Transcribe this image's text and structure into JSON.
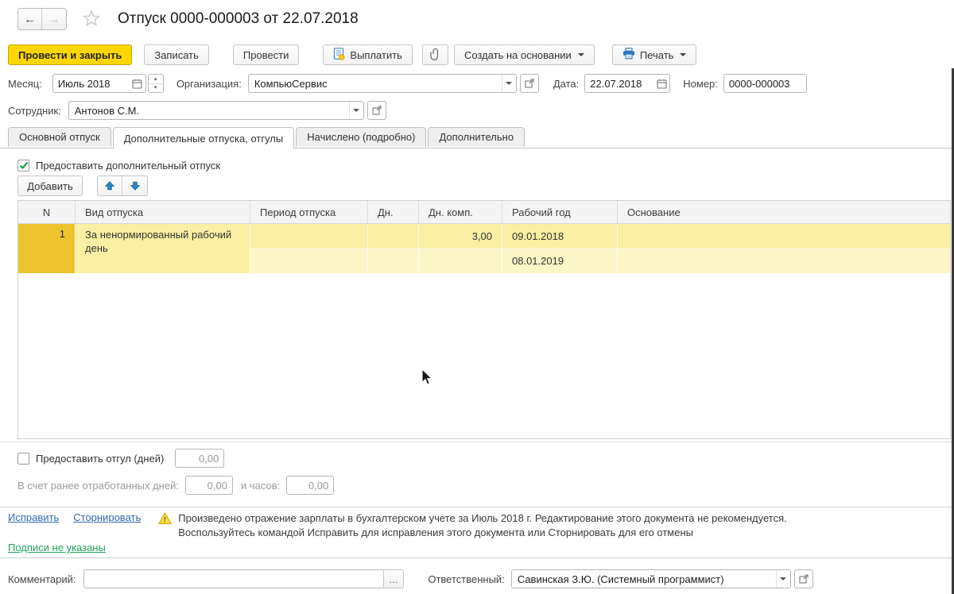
{
  "window": {
    "title": "Отпуск 0000-000003 от 22.07.2018"
  },
  "icons": {
    "back": "←",
    "forward": "→",
    "spin_up": "▴",
    "spin_down": "▾",
    "warning_glyph": "!"
  },
  "toolbar": {
    "post_and_close": "Провести и закрыть",
    "write": "Записать",
    "post": "Провести",
    "pay": "Выплатить",
    "create_based_on": "Создать на основании",
    "print": "Печать"
  },
  "header_fields": {
    "month_label": "Месяц:",
    "month_value": "Июль 2018",
    "organization_label": "Организация:",
    "organization_value": "КомпьюСервис",
    "date_label": "Дата:",
    "date_value": "22.07.2018",
    "number_label": "Номер:",
    "number_value": "0000-000003",
    "employee_label": "Сотрудник:",
    "employee_value": "Антонов С.М."
  },
  "tabs": [
    {
      "label": "Основной отпуск",
      "active": false
    },
    {
      "label": "Дополнительные отпуска, отгулы",
      "active": true
    },
    {
      "label": "Начислено (подробно)",
      "active": false
    },
    {
      "label": "Дополнительно",
      "active": false
    }
  ],
  "vacation_tab": {
    "grant_checkbox_label": "Предоставить дополнительный отпуск",
    "add_button": "Добавить",
    "table": {
      "columns": [
        "N",
        "Вид отпуска",
        "Период отпуска",
        "Дн.",
        "Дн. комп.",
        "Рабочий год",
        "Основание"
      ],
      "row": {
        "n": "1",
        "type": "За ненормированный рабочий день",
        "period_start": "",
        "period_end": "",
        "days": "",
        "days_comp": "3,00",
        "work_year_start": "09.01.2018",
        "work_year_end": "08.01.2019",
        "basis": ""
      }
    }
  },
  "time_off_section": {
    "grant_checkbox_label": "Предоставить отгул (дней)",
    "days_value": "0,00",
    "earned_days_label": "В счет ранее отработанных дней:",
    "earned_days_value": "0,00",
    "hours_label": "и часов:",
    "hours_value": "0,00"
  },
  "notice": {
    "fix_link": "Исправить",
    "reverse_link": "Сторнировать",
    "text_line1": "Произведено отражение зарплаты в бухгалтерском учете за Июль 2018 г. Редактирование этого документа не рекомендуется.",
    "text_line2": "Воспользуйтесь командой Исправить для исправления этого документа или Сторнировать для его отмены",
    "signatures_link": "Подписи не указаны"
  },
  "footer": {
    "comment_label": "Комментарий:",
    "comment_value": "",
    "more_button": "...",
    "responsible_label": "Ответственный:",
    "responsible_value": "Савинская З.Ю. (Системный программист)"
  },
  "colors": {
    "primary_button": "#fed702",
    "selected_row_marker": "#eec42e",
    "row_highlight": "#faefa2",
    "row_highlight_light": "#fcf5c6",
    "link": "#3169b3",
    "green_link": "#22a25c",
    "icon_blue": "#2e79c0"
  }
}
